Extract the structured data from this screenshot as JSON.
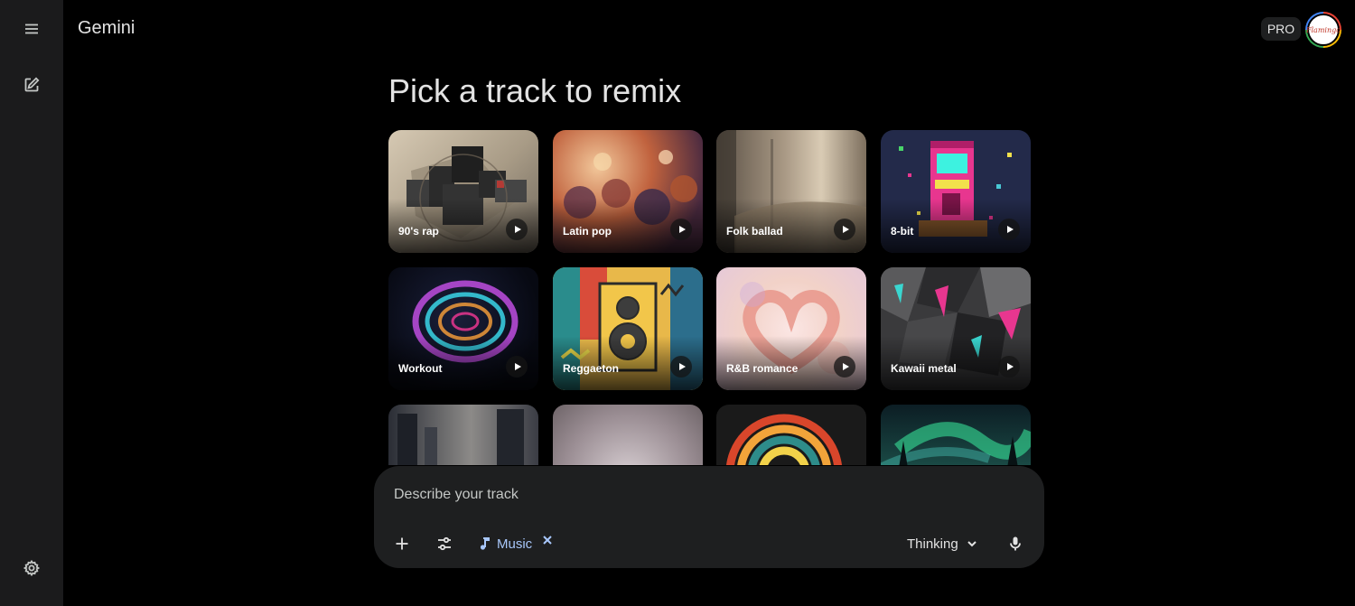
{
  "app": {
    "name": "Gemini",
    "badge": "PRO",
    "avatar_text": "Flamingo"
  },
  "sidebar": {
    "menu_icon": "hamburger-menu-icon",
    "new_chat_icon": "edit-icon",
    "settings_icon": "gear-icon"
  },
  "main": {
    "title": "Pick a track to remix",
    "tracks": [
      {
        "label": "90's rap",
        "theme": "collage-gray"
      },
      {
        "label": "Latin pop",
        "theme": "warm-crowd"
      },
      {
        "label": "Folk ballad",
        "theme": "sepia-window"
      },
      {
        "label": "8-bit",
        "theme": "arcade-pixel"
      },
      {
        "label": "Workout",
        "theme": "neon-swirl"
      },
      {
        "label": "Reggaeton",
        "theme": "speaker-pop-art"
      },
      {
        "label": "R&B romance",
        "theme": "heart-hands"
      },
      {
        "label": "Kawaii metal",
        "theme": "shards-pink-teal"
      },
      {
        "label": "",
        "theme": "misty-city"
      },
      {
        "label": "",
        "theme": "pale-haze"
      },
      {
        "label": "",
        "theme": "rainbow-spiral"
      },
      {
        "label": "",
        "theme": "aurora"
      }
    ]
  },
  "composer": {
    "placeholder": "Describe your track",
    "add_icon": "plus-icon",
    "tools_icon": "sliders-icon",
    "chip_label": "Music",
    "chip_icon": "music-note-icon",
    "mode": "Thinking",
    "mic_icon": "microphone-icon"
  },
  "colors": {
    "background": "#000000",
    "sidebar": "#1b1b1c",
    "composer": "#1e1f20",
    "accent": "#a8c7fa",
    "text": "#e3e3e3"
  }
}
